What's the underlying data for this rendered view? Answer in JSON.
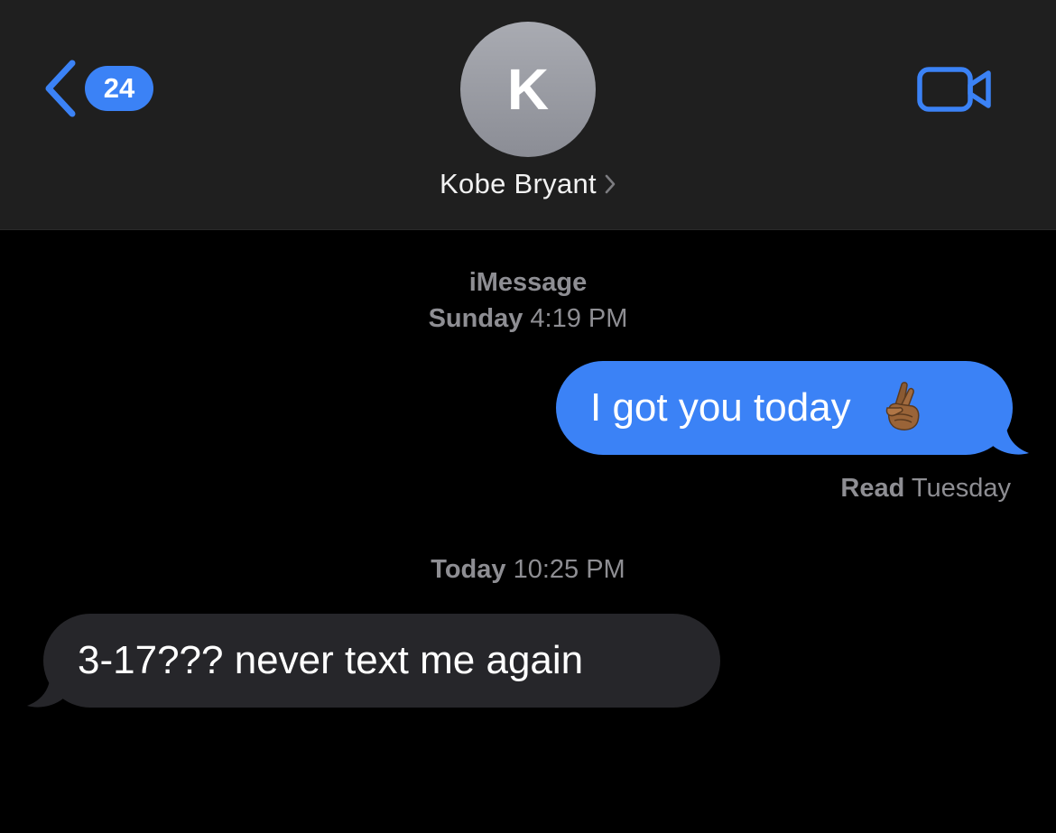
{
  "header": {
    "back": {
      "icon": "chevron-left-icon",
      "unread_count": "24"
    },
    "contact": {
      "avatar_initial": "K",
      "name": "Kobe Bryant",
      "name_chevron_icon": "chevron-right-icon"
    },
    "video_call_icon": "video-camera-icon"
  },
  "conversation": {
    "service_label": "iMessage",
    "first_timestamp": {
      "day": "Sunday",
      "time": "4:19 PM"
    },
    "messages": [
      {
        "direction": "sent",
        "text": "I got you today",
        "emoji_icon": "crossed-fingers-emoji"
      },
      {
        "direction": "received",
        "text": "3-17??? never text me again"
      }
    ],
    "read_receipt": {
      "label": "Read",
      "when": "Tuesday"
    },
    "second_timestamp": {
      "day": "Today",
      "time": "10:25 PM"
    }
  },
  "colors": {
    "accent_blue": "#3b82f6",
    "header_bg": "#1f1f1f",
    "received_bubble": "#26262a",
    "meta_gray": "#8e8e93"
  }
}
